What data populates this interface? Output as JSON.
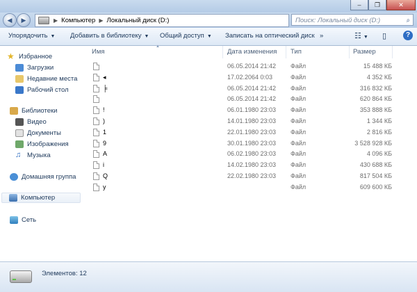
{
  "window": {
    "minimize_icon": "minimize-icon",
    "maximize_icon": "maximize-icon",
    "close_icon": "close-icon"
  },
  "address": {
    "segments": [
      "Компьютер",
      "Локальный диск (D:)"
    ],
    "search_placeholder": "Поиск: Локальный диск (D:)"
  },
  "toolbar": {
    "organize": "Упорядочить",
    "add_library": "Добавить в библиотеку",
    "share": "Общий доступ",
    "burn": "Записать на оптический диск",
    "more": "»"
  },
  "sidebar": {
    "favorites": "Избранное",
    "downloads": "Загрузки",
    "recent": "Недавние места",
    "desktop": "Рабочий стол",
    "libraries": "Библиотеки",
    "video": "Видео",
    "documents": "Документы",
    "images": "Изображения",
    "music": "Музыка",
    "homegroup": "Домашняя группа",
    "computer": "Компьютер",
    "network": "Сеть"
  },
  "columns": {
    "name": "Имя",
    "date": "Дата изменения",
    "type": "Тип",
    "size": "Размер"
  },
  "files": [
    {
      "name": "",
      "date": "06.05.2014 21:42",
      "type": "Файл",
      "size": "15 488 КБ"
    },
    {
      "name": "◂",
      "date": "17.02.2064 0:03",
      "type": "Файл",
      "size": "4 352 КБ"
    },
    {
      "name": "╞",
      "date": "06.05.2014 21:42",
      "type": "Файл",
      "size": "316 832 КБ"
    },
    {
      "name": "",
      "date": "06.05.2014 21:42",
      "type": "Файл",
      "size": "620 864 КБ"
    },
    {
      "name": "!",
      "date": "06.01.1980 23:03",
      "type": "Файл",
      "size": "353 888 КБ"
    },
    {
      "name": ")",
      "date": "14.01.1980 23:03",
      "type": "Файл",
      "size": "1 344 КБ"
    },
    {
      "name": "1",
      "date": "22.01.1980 23:03",
      "type": "Файл",
      "size": "2 816 КБ"
    },
    {
      "name": "9",
      "date": "30.01.1980 23:03",
      "type": "Файл",
      "size": "3 528 928 КБ"
    },
    {
      "name": "A",
      "date": "06.02.1980 23:03",
      "type": "Файл",
      "size": "4 096 КБ"
    },
    {
      "name": "i",
      "date": "14.02.1980 23:03",
      "type": "Файл",
      "size": "430 688 КБ"
    },
    {
      "name": "Q",
      "date": "22.02.1980 23:03",
      "type": "Файл",
      "size": "817 504 КБ"
    },
    {
      "name": "y",
      "date": "",
      "type": "Файл",
      "size": "609 600 КБ"
    }
  ],
  "status": {
    "count": "Элементов: 12"
  }
}
